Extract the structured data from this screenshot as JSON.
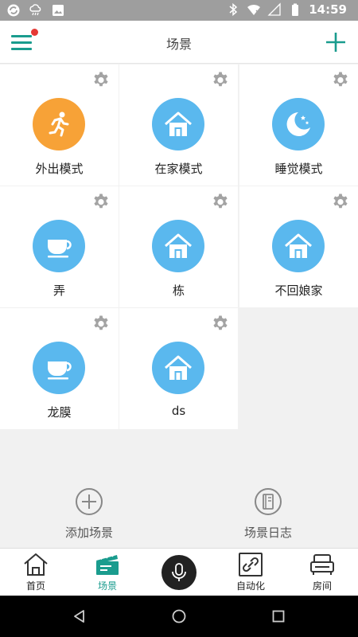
{
  "status_bar": {
    "time": "14:59"
  },
  "header": {
    "title": "场景"
  },
  "scenes": [
    {
      "label": "外出模式",
      "icon": "running-person-icon",
      "color": "#f7a237"
    },
    {
      "label": "在家模式",
      "icon": "house-icon",
      "color": "#5ab8ee"
    },
    {
      "label": "睡觉模式",
      "icon": "moon-stars-icon",
      "color": "#5ab8ee"
    },
    {
      "label": "弄",
      "icon": "cup-icon",
      "color": "#5ab8ee"
    },
    {
      "label": "栋",
      "icon": "house-icon",
      "color": "#5ab8ee"
    },
    {
      "label": "不回娘家",
      "icon": "house-icon",
      "color": "#5ab8ee"
    },
    {
      "label": "龙膜",
      "icon": "cup-icon",
      "color": "#5ab8ee"
    },
    {
      "label": "ds",
      "icon": "house-icon",
      "color": "#5ab8ee"
    }
  ],
  "actions": {
    "add_scene": "添加场景",
    "scene_log": "场景日志"
  },
  "nav": {
    "home": "首页",
    "scenes": "场景",
    "automation": "自动化",
    "rooms": "房间"
  },
  "colors": {
    "accent": "#1a9c8e",
    "scene_blue": "#5ab8ee",
    "scene_orange": "#f7a237"
  }
}
